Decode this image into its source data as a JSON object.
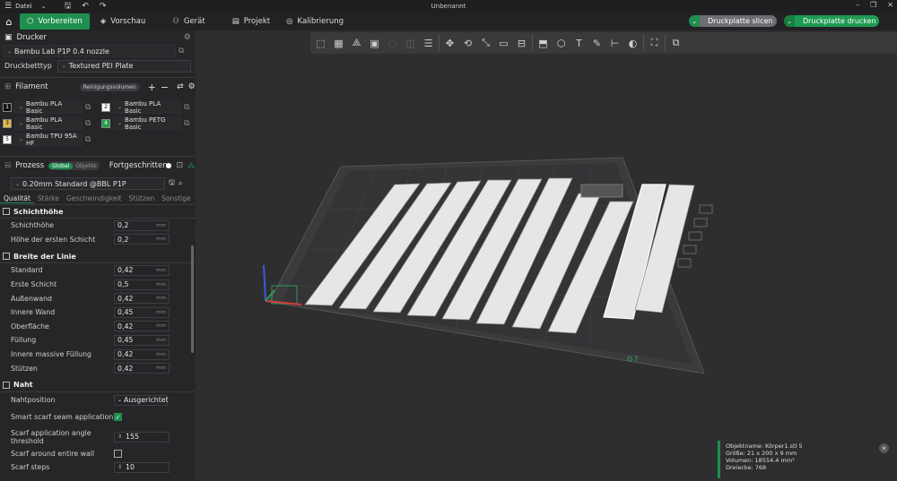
{
  "topbar": {
    "menu_label": "Datei",
    "title": "Unbenannt"
  },
  "tabs": [
    {
      "label": "Vorbereiten",
      "icon": "cube-icon"
    },
    {
      "label": "Vorschau",
      "icon": "layers-icon"
    },
    {
      "label": "Gerät",
      "icon": "device-icon"
    },
    {
      "label": "Projekt",
      "icon": "project-icon"
    },
    {
      "label": "Kalibrierung",
      "icon": "calibration-icon"
    }
  ],
  "actions": {
    "slice_label": "Druckplatte slicen",
    "print_label": "Druckplatte drucken"
  },
  "printer": {
    "header": "Drucker",
    "name": "Bambu Lab P1P 0.4 nozzle",
    "bed_label": "Druckbetttyp",
    "bed_value": "Textured PEI Plate"
  },
  "filament": {
    "header": "Filament",
    "flush_label": "Reinigungsvolumen",
    "items": [
      {
        "num": "1",
        "name": "Bambu PLA Basic",
        "color": "#111111",
        "numcolor": "#ffffff"
      },
      {
        "num": "2",
        "name": "Bambu PLA Basic",
        "color": "#ffffff",
        "numcolor": "#000000"
      },
      {
        "num": "3",
        "name": "Bambu PLA Basic",
        "color": "#e6b84e",
        "numcolor": "#000000"
      },
      {
        "num": "4",
        "name": "Bambu PETG Basic",
        "color": "#1d9e4a",
        "numcolor": "#ffffff"
      },
      {
        "num": "5",
        "name": "Bambu TPU 95A HF",
        "color": "#ffffff",
        "numcolor": "#000000"
      }
    ]
  },
  "process": {
    "header": "Prozess",
    "global_label": "Global",
    "objects_label": "Objekte",
    "advanced_label": "Fortgeschritten",
    "preset": "0.20mm Standard @BBL P1P",
    "tabs": [
      "Qualität",
      "Stärke",
      "Geschwindigkeit",
      "Stützen",
      "Sonstige"
    ],
    "groups": {
      "layer": {
        "title": "Schichthöhe",
        "rows": [
          {
            "label": "Schichthöhe",
            "value": "0,2",
            "unit": "mm"
          },
          {
            "label": "Höhe der ersten Schicht",
            "value": "0,2",
            "unit": "mm"
          }
        ]
      },
      "width": {
        "title": "Breite der Linie",
        "rows": [
          {
            "label": "Standard",
            "value": "0,42",
            "unit": "mm"
          },
          {
            "label": "Erste Schicht",
            "value": "0,5",
            "unit": "mm"
          },
          {
            "label": "Außenwand",
            "value": "0,42",
            "unit": "mm"
          },
          {
            "label": "Innere Wand",
            "value": "0,45",
            "unit": "mm"
          },
          {
            "label": "Oberfläche",
            "value": "0,42",
            "unit": "mm"
          },
          {
            "label": "Füllung",
            "value": "0,45",
            "unit": "mm"
          },
          {
            "label": "Innere massive Füllung",
            "value": "0,42",
            "unit": "mm"
          },
          {
            "label": "Stützen",
            "value": "0,42",
            "unit": "mm"
          }
        ]
      },
      "seam": {
        "title": "Naht",
        "position_label": "Nahtposition",
        "position_value": "Ausgerichtet",
        "smart_label": "Smart scarf seam application",
        "angle_label": "Scarf application angle threshold",
        "angle_value": "155",
        "around_label": "Scarf around entire wall",
        "steps_label": "Scarf steps",
        "steps_value": "10"
      }
    }
  },
  "object_info": {
    "name": "Objektname: Körper1.stl 5",
    "size": "Größe: 21 x 200 x 9 mm",
    "volume": "Volumen: 18554.4 mm³",
    "triangles": "Dreiecke: 768"
  },
  "colors": {
    "accent": "#1e8f4e"
  }
}
